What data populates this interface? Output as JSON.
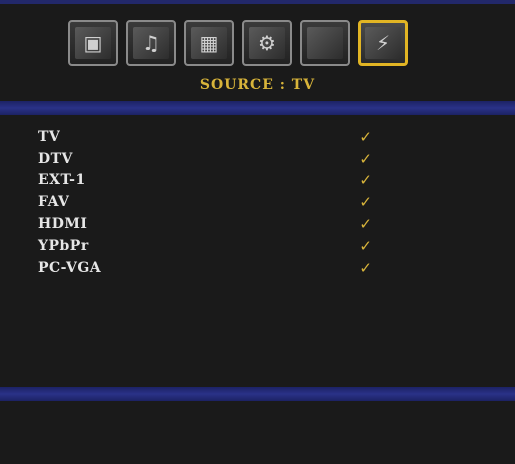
{
  "header": {
    "title": "SOURCE : TV"
  },
  "tabs": [
    {
      "name": "picture-icon",
      "glyph": "▣",
      "active": false
    },
    {
      "name": "sound-icon",
      "glyph": "♫",
      "active": false
    },
    {
      "name": "feature-icon",
      "glyph": "▦",
      "active": false
    },
    {
      "name": "setup-icon",
      "glyph": "⚙",
      "active": false
    },
    {
      "name": "blank-icon",
      "glyph": "",
      "active": false
    },
    {
      "name": "source-icon",
      "glyph": "⚡",
      "active": true
    }
  ],
  "sources": [
    {
      "label": "TV",
      "mark": "✓"
    },
    {
      "label": "DTV",
      "mark": "✓"
    },
    {
      "label": "EXT-1",
      "mark": "✓"
    },
    {
      "label": "FAV",
      "mark": "✓"
    },
    {
      "label": "HDMI",
      "mark": "✓"
    },
    {
      "label": "YPbPr",
      "mark": "✓"
    },
    {
      "label": "PC-VGA",
      "mark": "✓"
    }
  ],
  "colors": {
    "accent": "#d8b43a",
    "divider": "#2a3288",
    "background": "#1a1a1a"
  }
}
